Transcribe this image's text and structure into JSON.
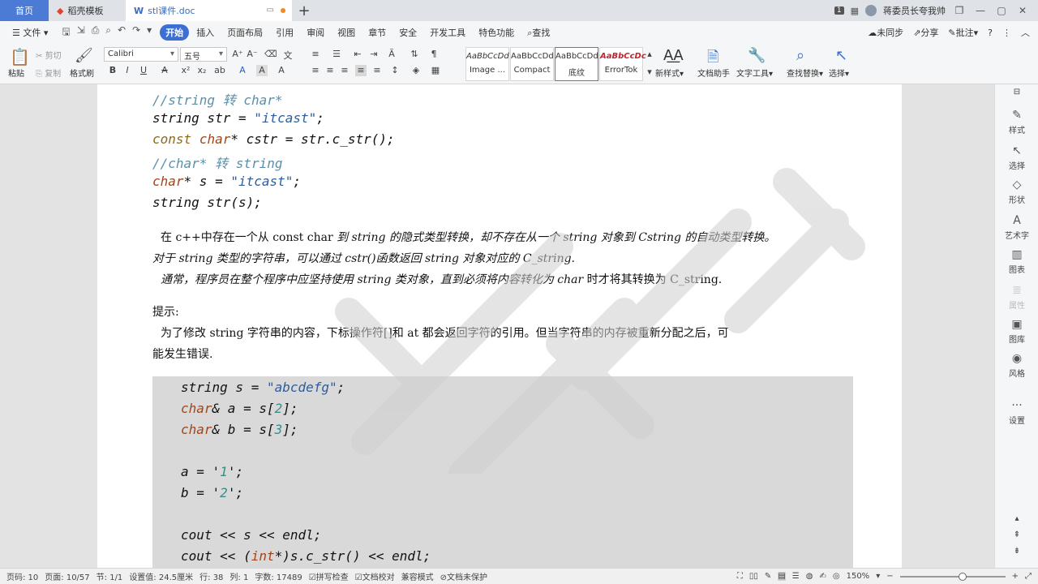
{
  "tabs": {
    "home": "首页",
    "template": "稻壳模板",
    "document": "stl课件.doc",
    "new_tab": "+"
  },
  "titlebar": {
    "page_badge": "1",
    "user": "蒋委员长夸我帅"
  },
  "menu": {
    "file": "文件",
    "items": [
      "开始",
      "插入",
      "页面布局",
      "引用",
      "审阅",
      "视图",
      "章节",
      "安全",
      "开发工具",
      "特色功能"
    ],
    "search": "查找",
    "sync": "未同步",
    "share": "分享",
    "comment": "批注"
  },
  "ribbon": {
    "paste": "粘贴",
    "cut": "剪切",
    "copy": "复制",
    "format_painter": "格式刷",
    "font_name": "Calibri",
    "font_size": "五号",
    "styles": [
      {
        "sample": "AaBbCcDd",
        "name": "Image ..."
      },
      {
        "sample": "AaBbCcDd",
        "name": "Compact"
      },
      {
        "sample": "AaBbCcDd",
        "name": "底纹"
      },
      {
        "sample": "AaBbCcDc",
        "name": "ErrorTok"
      }
    ],
    "new_style": "新样式",
    "doc_assistant": "文档助手",
    "text_tools": "文字工具",
    "find_replace": "查找替换",
    "select": "选择"
  },
  "document": {
    "code_top": [
      "//string 转 char*",
      "string str = \"itcast\";",
      "const char* cstr = str.c_str();",
      "//char* 转 string",
      "char* s = \"itcast\";",
      "string str(s);"
    ],
    "para1_a": "在 c++中存在一个从 const char ",
    "para1_b": "到 string 的隐式类型转换，却不存在从一个 string 对象到 Cstring 的自动类型转换。",
    "para2": "对于 string 类型的字符串，可以通过 cstr()函数返回 string 对象对应的 C_string.",
    "para3_a": "通常，程序员在整个程序中应坚持使用 string 类对象，直到必须将内容转化为 char ",
    "para3_b": "时才将其转换为 C_string.",
    "hint_title": "提示:",
    "hint_line1": "为了修改 string 字符串的内容，下标操作符[]和 at 都会返回字符的引用。但当字符串的内存被重新分配之后，可",
    "hint_line2": "能发生错误.",
    "code_block": [
      "string s = \"abcdefg\";",
      "char& a = s[2];",
      "char& b = s[3];",
      "",
      "a = '1';",
      "b = '2';",
      "",
      "cout << s << endl;",
      "cout << (int*)s.c_str() << endl;"
    ]
  },
  "sidebar": [
    "样式",
    "选择",
    "形状",
    "艺术字",
    "图表",
    "属性",
    "图库",
    "风格",
    "设置"
  ],
  "status": {
    "page_code": "页码: 10",
    "page": "页面: 10/57",
    "section": "节: 1/1",
    "setting": "设置值: 24.5厘米",
    "row": "行: 38",
    "col": "列: 1",
    "words": "字数: 17489",
    "spell": "拼写检查",
    "proof": "文档校对",
    "compat": "兼容模式",
    "protect": "文档未保护",
    "zoom": "150%"
  },
  "colors": {
    "accent": "#3b6fd4",
    "comment": "#5b8fa8",
    "keyword": "#8a6b1e",
    "string": "#2e5d9a"
  }
}
